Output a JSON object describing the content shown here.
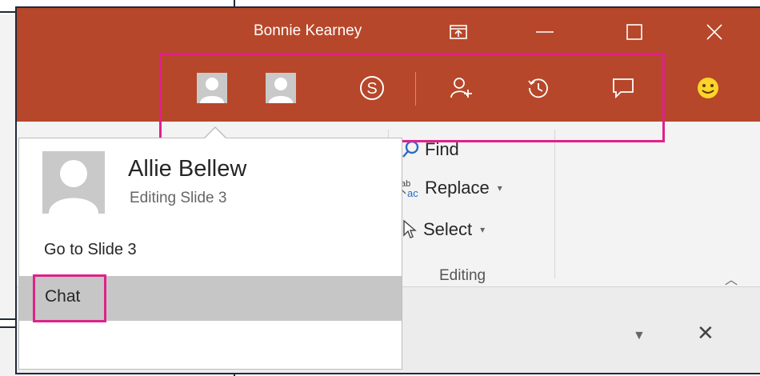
{
  "window": {
    "title": "Bonnie Kearney"
  },
  "collaboration": {
    "buttons": [
      {
        "name": "coauthor-avatar-1"
      },
      {
        "name": "coauthor-avatar-2"
      },
      {
        "name": "skype-icon"
      },
      {
        "name": "share-icon"
      },
      {
        "name": "activity-icon"
      },
      {
        "name": "comments-icon"
      },
      {
        "name": "smiley-icon"
      }
    ],
    "highlight_color": "#e0218a"
  },
  "ribbon": {
    "editing": {
      "find_label": "Find",
      "replace_label": "Replace",
      "select_label": "Select",
      "group_label": "Editing"
    }
  },
  "popup": {
    "name": "Allie Bellew",
    "status": "Editing Slide 3",
    "goto_label": "Go to Slide 3",
    "chat_label": "Chat"
  },
  "colors": {
    "title_bar": "#b7472a",
    "highlight": "#e0218a",
    "chat_row": "#c6c6c6"
  }
}
